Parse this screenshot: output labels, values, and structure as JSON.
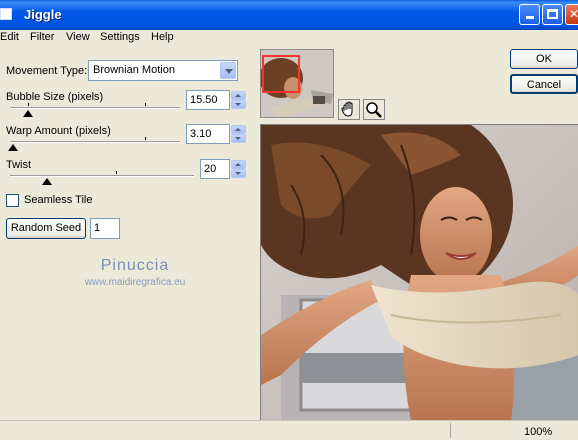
{
  "window": {
    "title": "Jiggle"
  },
  "menu": [
    "Edit",
    "Filter",
    "View",
    "Settings",
    "Help"
  ],
  "movement": {
    "label": "Movement Type:",
    "value": "Brownian Motion"
  },
  "bubble_size": {
    "label": "Bubble Size (pixels)",
    "value": "15.50"
  },
  "warp_amount": {
    "label": "Warp Amount (pixels)",
    "value": "3.10"
  },
  "twist": {
    "label": "Twist",
    "value": "20"
  },
  "seamless": {
    "label": "Seamless Tile",
    "checked": false
  },
  "random_seed": {
    "button": "Random Seed",
    "value": "1"
  },
  "watermark": {
    "line1": "Pinuccia",
    "line2": "www.maidiregrafica.eu"
  },
  "buttons": {
    "ok": "OK",
    "cancel": "Cancel"
  },
  "status": {
    "zoom": "100%"
  },
  "colors": {
    "titlebar": "#0054e3",
    "accent": "#003c74",
    "thumbnail_frame": "#ff3030"
  }
}
